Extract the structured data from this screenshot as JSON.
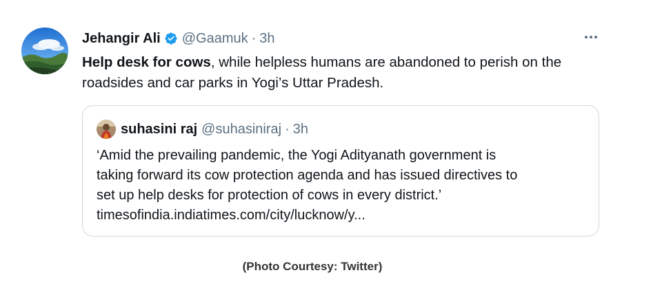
{
  "tweet": {
    "author_name": "Jehangir Ali",
    "handle": "@Gaamuk",
    "separator": "·",
    "time": "3h",
    "verified_icon": "verified-badge-icon",
    "more_icon": "more-options-icon",
    "text_bold": "Help desk for cows",
    "text_rest": ", while helpless humans are abandoned to perish on the roadsides and car parks in Yogi’s Uttar Pradesh."
  },
  "quoted_tweet": {
    "author_name": "suhasini raj",
    "handle": "@suhasiniraj",
    "separator": "·",
    "time": "3h",
    "lines": [
      "‘Amid the prevailing pandemic, the Yogi Adityanath government is",
      "taking forward its cow protection agenda and has issued directives to",
      "set up help desks for protection of cows in every district.’",
      "timesofindia.indiatimes.com/city/lucknow/y..."
    ]
  },
  "caption": "(Photo Courtesy: Twitter)",
  "colors": {
    "text": "#0f1419",
    "secondary": "#5b7083",
    "border": "#cfd9de",
    "verified": "#1d9bf0"
  }
}
